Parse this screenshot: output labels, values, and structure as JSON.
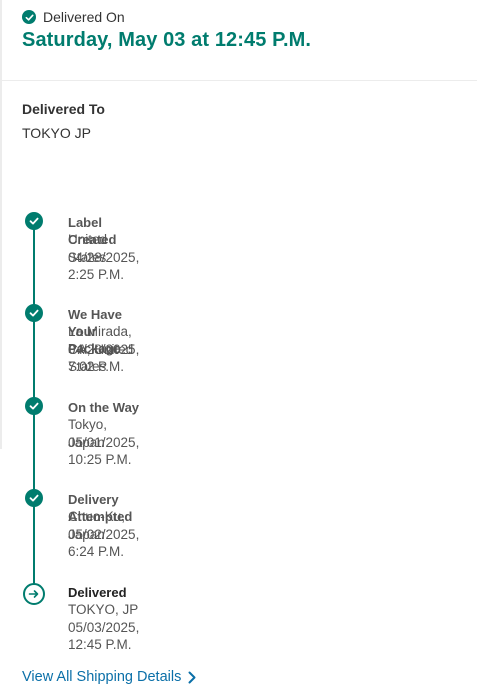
{
  "header": {
    "status_label": "Delivered On",
    "delivery_date": "Saturday, May 03 at 12:45 P.M."
  },
  "destination": {
    "label": "Delivered To",
    "value": "TOKYO JP"
  },
  "timeline": {
    "events": [
      {
        "title": "Label Created",
        "location": "United States",
        "datetime": "04/28/2025, 2:25 P.M."
      },
      {
        "title": "We Have Your Package",
        "location": "La Mirada, CA, United States",
        "datetime": "04/28/2025, 7:02 P.M."
      },
      {
        "title": "On the Way",
        "location": "Tokyo, Japan",
        "datetime": "05/01/2025, 10:25 P.M."
      },
      {
        "title": "Delivery Attempted",
        "location": "Chuo-Ku, Japan",
        "datetime": "05/02/2025, 6:24 P.M."
      },
      {
        "title": "Delivered",
        "location": "TOKYO, JP",
        "datetime": "05/03/2025, 12:45 P.M."
      }
    ]
  },
  "footer": {
    "view_all_label": "View All Shipping Details"
  },
  "icons": {
    "status": "check-circle-icon",
    "completed_step": "check-circle-icon",
    "current_step": "arrow-right-circle-icon",
    "link": "chevron-right-icon"
  },
  "colors": {
    "accent": "#007c6e",
    "link": "#0a6fa8",
    "text": "#333333",
    "muted": "#555555"
  }
}
